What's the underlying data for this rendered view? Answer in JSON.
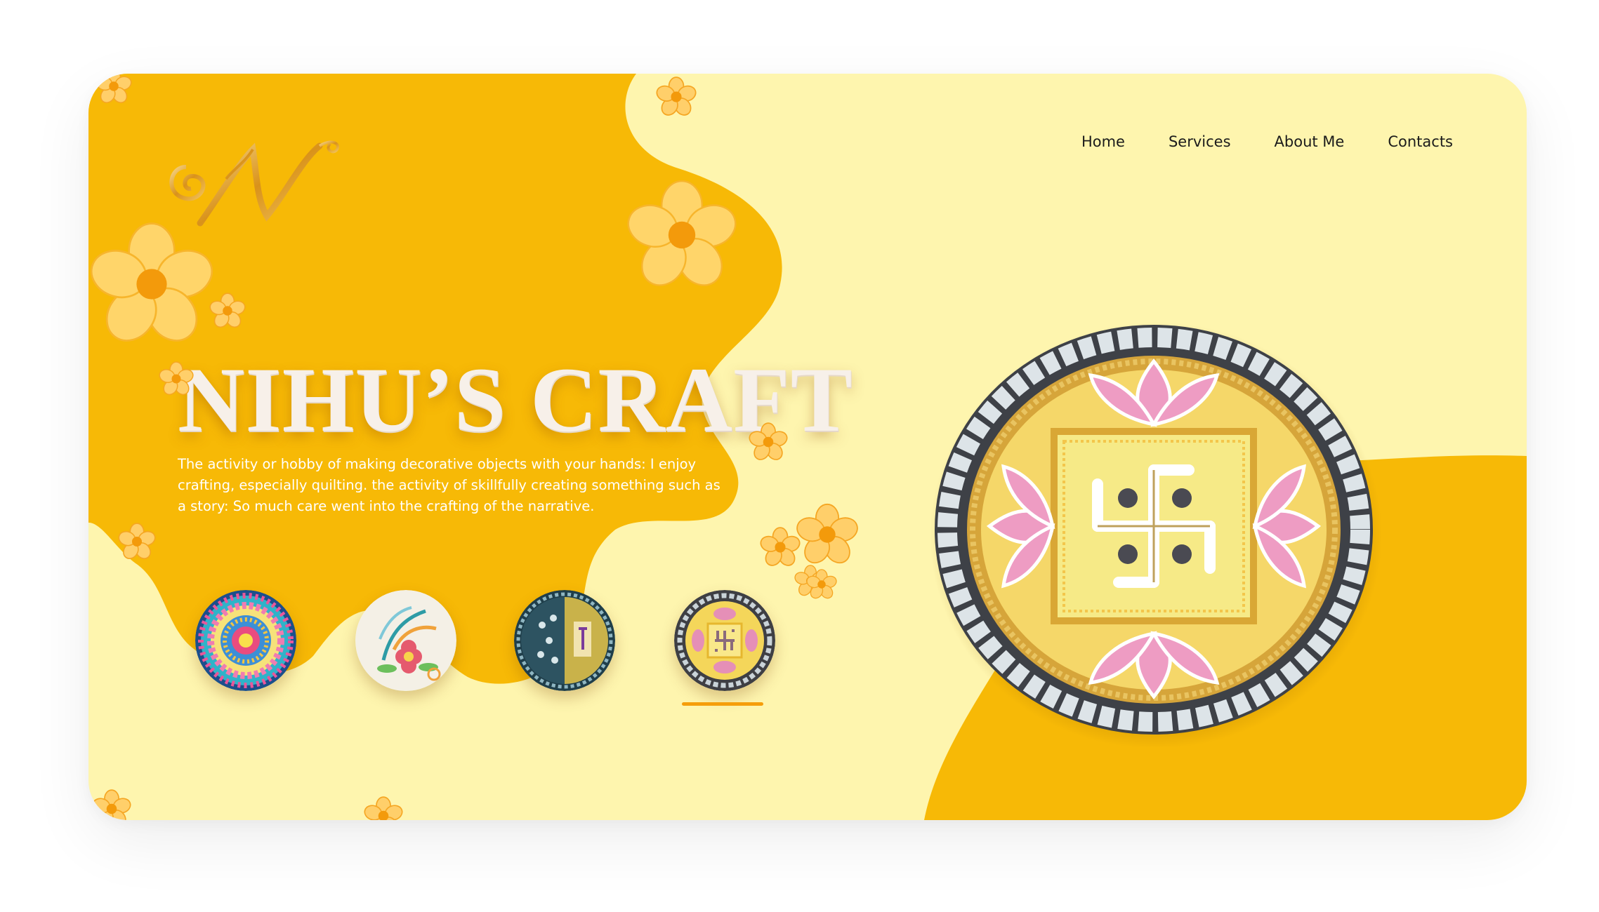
{
  "brand": {
    "logo_letter": "N"
  },
  "nav": {
    "items": [
      {
        "label": "Home"
      },
      {
        "label": "Services"
      },
      {
        "label": "About Me"
      },
      {
        "label": "Contacts"
      }
    ]
  },
  "hero": {
    "title": "NIHU’S CRAFT",
    "description": "The activity or hobby of making decorative objects with your hands: I enjoy crafting, especially quilting. the activity of skillfully creating something such as a story: So much care went into the crafting of the narrative."
  },
  "gallery": {
    "selected_index": 3,
    "thumbnails": [
      {
        "name": "mandala-dot-art"
      },
      {
        "name": "quilling-flower"
      },
      {
        "name": "lippan-mirror-art"
      },
      {
        "name": "swastik-lotus-plate"
      }
    ]
  },
  "featured": {
    "name": "swastik-lotus-mirror-plate"
  },
  "colors": {
    "background": "#FEF5AE",
    "accent": "#F7B906",
    "indicator": "#F59E0B",
    "text": "#1b1b1b"
  }
}
